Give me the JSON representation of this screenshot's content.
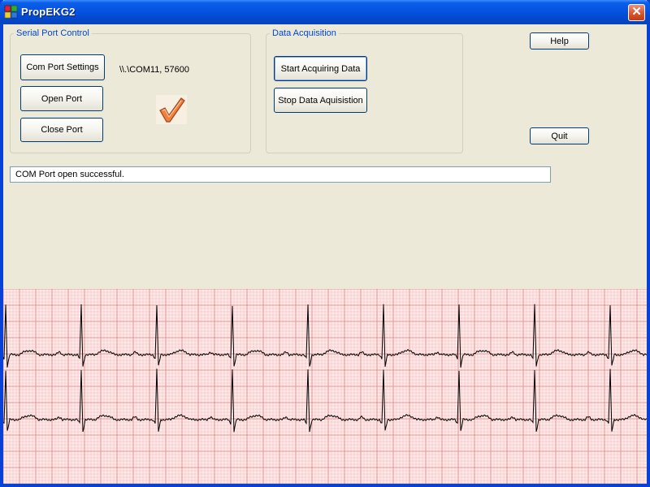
{
  "window": {
    "title": "PropEKG2",
    "close_symbol": "✕"
  },
  "serial_port": {
    "legend": "Serial Port Control",
    "com_settings_label": "Com Port Settings",
    "open_port_label": "Open Port",
    "close_port_label": "Close Port",
    "port_info": "\\\\.\\COM11, 57600",
    "status_icon": "checkmark-icon"
  },
  "data_acquisition": {
    "legend": "Data Acquisition",
    "start_label": "Start Acquiring Data",
    "stop_label": "Stop Data Aquisistion"
  },
  "help_label": "Help",
  "quit_label": "Quit",
  "status_message": "COM Port open successful.",
  "colors": {
    "accent": "#0046d5",
    "ekg_grid_minor": "#f4b9b9",
    "ekg_grid_major": "#e57e7e",
    "ekg_background": "#fdeaea",
    "ekg_trace": "#000000",
    "checkmark": "#f08040"
  },
  "ekg": {
    "traces": 2,
    "beat_count": 9
  }
}
